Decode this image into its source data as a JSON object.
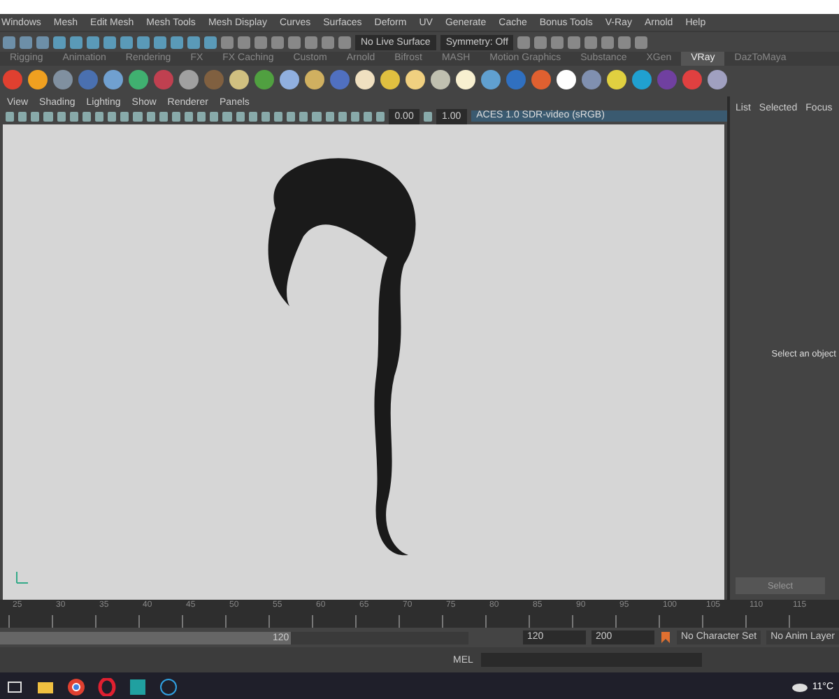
{
  "menu_bar": [
    "Windows",
    "Mesh",
    "Edit Mesh",
    "Mesh Tools",
    "Mesh Display",
    "Curves",
    "Surfaces",
    "Deform",
    "UV",
    "Generate",
    "Cache",
    "Bonus Tools",
    "V-Ray",
    "Arnold",
    "Help"
  ],
  "status_line": {
    "live_surface": "No Live Surface",
    "symmetry": "Symmetry: Off"
  },
  "shelf_tabs": [
    {
      "label": "Rigging",
      "selected": false
    },
    {
      "label": "Animation",
      "selected": false
    },
    {
      "label": "Rendering",
      "selected": false
    },
    {
      "label": "FX",
      "selected": false
    },
    {
      "label": "FX Caching",
      "selected": false
    },
    {
      "label": "Custom",
      "selected": false
    },
    {
      "label": "Arnold",
      "selected": false
    },
    {
      "label": "Bifrost",
      "selected": false
    },
    {
      "label": "MASH",
      "selected": false
    },
    {
      "label": "Motion Graphics",
      "selected": false
    },
    {
      "label": "Substance",
      "selected": false
    },
    {
      "label": "XGen",
      "selected": false
    },
    {
      "label": "VRay",
      "selected": true
    },
    {
      "label": "DazToMaya",
      "selected": false
    }
  ],
  "viewport": {
    "menu": [
      "View",
      "Shading",
      "Lighting",
      "Show",
      "Renderer",
      "Panels"
    ],
    "exposure": "0.00",
    "gamma": "1.00",
    "color_space": "ACES 1.0 SDR-video (sRGB)"
  },
  "attribute_panel": {
    "tabs": [
      "List",
      "Selected",
      "Focus"
    ],
    "message": "Select an object",
    "button": "Select"
  },
  "timeline": {
    "ticks": [
      "25",
      "30",
      "35",
      "40",
      "45",
      "50",
      "55",
      "60",
      "65",
      "70",
      "75",
      "80",
      "85",
      "90",
      "95",
      "100",
      "105",
      "110",
      "115"
    ]
  },
  "range": {
    "level": 0.62,
    "slider_end": "120",
    "end": "120",
    "max": "200",
    "character_set": "No Character Set",
    "anim_layer": "No Anim Layer"
  },
  "command_line": {
    "language": "MEL"
  },
  "taskbar": {
    "weather": "11°C"
  }
}
